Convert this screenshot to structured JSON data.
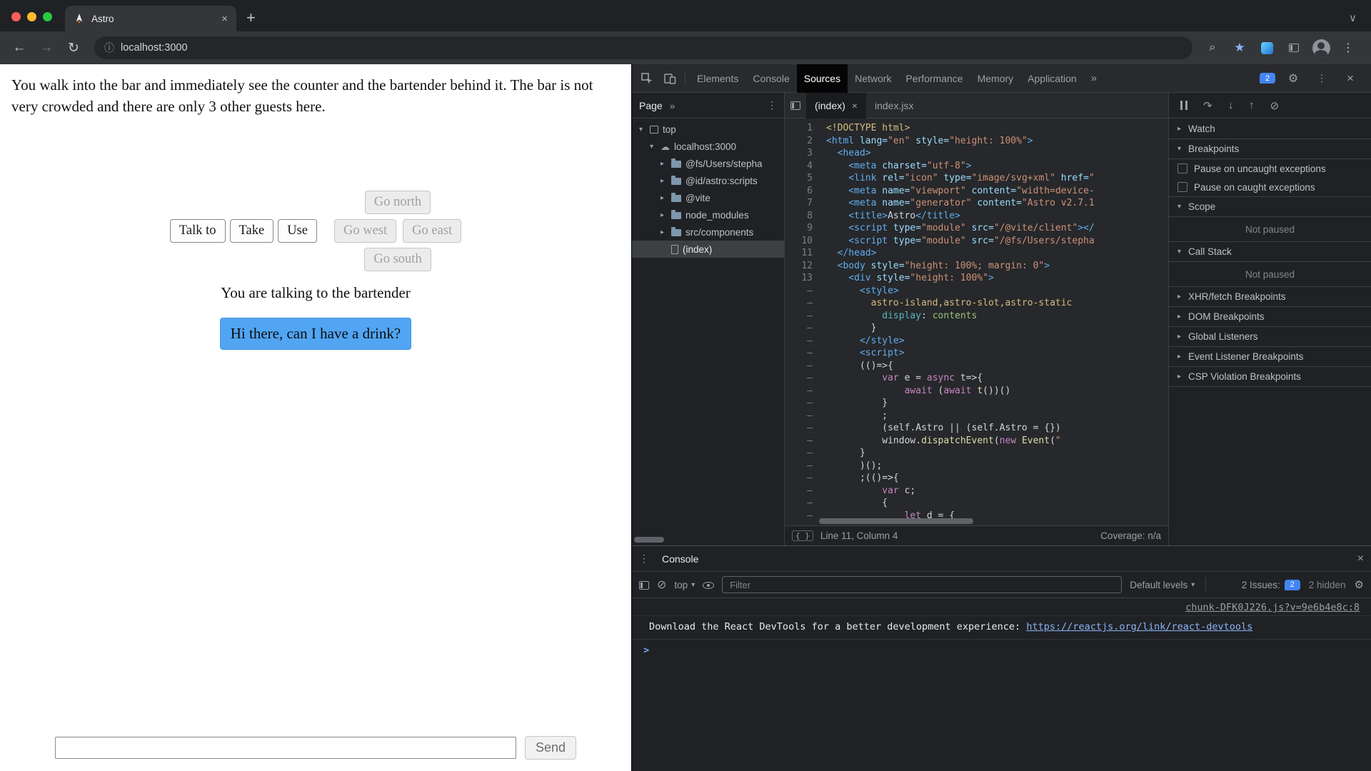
{
  "colors": {
    "accent_blue": "#51a5f3",
    "link_blue": "#8ab4f8",
    "issue_blue": "#4285f4",
    "traffic_red": "#ff5f57",
    "traffic_yellow": "#febc2e",
    "traffic_green": "#28c840"
  },
  "icons": {
    "back": "←",
    "forward": "→",
    "reload": "↻",
    "info": "ⓘ",
    "star": "★",
    "kebab": "⋮",
    "close": "×",
    "new_tab": "+",
    "chevron_down": "∨",
    "more": "»",
    "gear": "⚙",
    "clear": "⊘",
    "caret": "▾",
    "prompt": ">",
    "step_over": "↷",
    "step_into": "↓",
    "step_out": "↑",
    "deactivate": "⊘",
    "search": "⌕"
  },
  "browser": {
    "tab_title": "Astro",
    "url": "localhost:3000"
  },
  "page": {
    "narrative": "You walk into the bar and immediately see the counter and the bartender behind it. The bar is not very crowded and there are only 3 other guests here.",
    "buttons": {
      "go_north": "Go north",
      "talk_to": "Talk to",
      "take": "Take",
      "use": "Use",
      "go_west": "Go west",
      "go_east": "Go east",
      "go_south": "Go south"
    },
    "status_text": "You are talking to the bartender",
    "dialog_option": "Hi there, can I have a drink?",
    "input_value": "",
    "send_label": "Send"
  },
  "devtools": {
    "tabs": [
      "Elements",
      "Console",
      "Sources",
      "Network",
      "Performance",
      "Memory",
      "Application"
    ],
    "active_tab": "Sources",
    "issues_count": "2",
    "sources": {
      "pane_tab": "Page",
      "tree": [
        {
          "label": "top",
          "icon": "frame",
          "arrow": "▾",
          "indent": 0
        },
        {
          "label": "localhost:3000",
          "icon": "cloud",
          "arrow": "▾",
          "indent": 1
        },
        {
          "label": "@fs/Users/stepha",
          "icon": "folder",
          "arrow": "▸",
          "indent": 2
        },
        {
          "label": "@id/astro:scripts",
          "icon": "folder",
          "arrow": "▸",
          "indent": 2
        },
        {
          "label": "@vite",
          "icon": "folder",
          "arrow": "▸",
          "indent": 2
        },
        {
          "label": "node_modules",
          "icon": "folder",
          "arrow": "▸",
          "indent": 2
        },
        {
          "label": "src/components",
          "icon": "folder",
          "arrow": "▸",
          "indent": 2
        },
        {
          "label": "(index)",
          "icon": "file",
          "arrow": "",
          "indent": 2,
          "selected": true
        }
      ],
      "editor_tabs": [
        {
          "label": "(index)",
          "active": true,
          "closable": true
        },
        {
          "label": "index.jsx",
          "active": false,
          "closable": false
        }
      ],
      "code": [
        {
          "n": "1",
          "s": [
            [
              "dt",
              "<!DOCTYPE html>"
            ]
          ]
        },
        {
          "n": "2",
          "s": [
            [
              "tg",
              "<html"
            ],
            [
              "at",
              " lang="
            ],
            [
              "st",
              "\"en\""
            ],
            [
              "at",
              " style="
            ],
            [
              "st",
              "\"height: 100%\""
            ],
            [
              "tg",
              ">"
            ]
          ]
        },
        {
          "n": "3",
          "s": [
            [
              "tg",
              "  <head>"
            ]
          ]
        },
        {
          "n": "4",
          "s": [
            [
              "tg",
              "    <meta"
            ],
            [
              "at",
              " charset="
            ],
            [
              "st",
              "\"utf-8\""
            ],
            [
              "tg",
              ">"
            ]
          ]
        },
        {
          "n": "5",
          "s": [
            [
              "tg",
              "    <link"
            ],
            [
              "at",
              " rel="
            ],
            [
              "st",
              "\"icon\""
            ],
            [
              "at",
              " type="
            ],
            [
              "st",
              "\"image/svg+xml\""
            ],
            [
              "at",
              " href="
            ],
            [
              "st",
              "\""
            ]
          ]
        },
        {
          "n": "6",
          "s": [
            [
              "tg",
              "    <meta"
            ],
            [
              "at",
              " name="
            ],
            [
              "st",
              "\"viewport\""
            ],
            [
              "at",
              " content="
            ],
            [
              "st",
              "\"width=device-"
            ]
          ]
        },
        {
          "n": "7",
          "s": [
            [
              "tg",
              "    <meta"
            ],
            [
              "at",
              " name="
            ],
            [
              "st",
              "\"generator\""
            ],
            [
              "at",
              " content="
            ],
            [
              "st",
              "\"Astro v2.7.1"
            ]
          ]
        },
        {
          "n": "8",
          "s": [
            [
              "tg",
              "    <title>"
            ],
            [
              "pl",
              "Astro"
            ],
            [
              "tg",
              "</title>"
            ]
          ]
        },
        {
          "n": "9",
          "s": [
            [
              "tg",
              "    <script"
            ],
            [
              "at",
              " type="
            ],
            [
              "st",
              "\"module\""
            ],
            [
              "at",
              " src="
            ],
            [
              "st",
              "\"/@vite/client\""
            ],
            [
              "tg",
              "></"
            ]
          ]
        },
        {
          "n": "10",
          "s": [
            [
              "tg",
              "    <script"
            ],
            [
              "at",
              " type="
            ],
            [
              "st",
              "\"module\""
            ],
            [
              "at",
              " src="
            ],
            [
              "st",
              "\"/@fs/Users/stepha"
            ]
          ]
        },
        {
          "n": "11",
          "s": [
            [
              "tg",
              "  </head>"
            ]
          ]
        },
        {
          "n": "12",
          "s": [
            [
              "tg",
              "  <body"
            ],
            [
              "at",
              " style="
            ],
            [
              "st",
              "\"height: 100%; margin: 0\""
            ],
            [
              "tg",
              ">"
            ]
          ]
        },
        {
          "n": "13",
          "s": [
            [
              "tg",
              "    <div"
            ],
            [
              "at",
              " style="
            ],
            [
              "st",
              "\"height: 100%\""
            ],
            [
              "tg",
              ">"
            ]
          ]
        },
        {
          "n": "–",
          "s": [
            [
              "tg",
              "      <style>"
            ]
          ]
        },
        {
          "n": "–",
          "s": [
            [
              "sel",
              "        astro-island,astro-slot,astro-static"
            ]
          ]
        },
        {
          "n": "–",
          "s": [
            [
              "pr",
              "          display"
            ],
            [
              "pl",
              ": "
            ],
            [
              "vl",
              "contents"
            ]
          ]
        },
        {
          "n": "–",
          "s": [
            [
              "pl",
              "        }"
            ]
          ]
        },
        {
          "n": "–",
          "s": [
            [
              "tg",
              "      </style>"
            ]
          ]
        },
        {
          "n": "–",
          "s": [
            [
              "tg",
              "      <script>"
            ]
          ]
        },
        {
          "n": "–",
          "s": [
            [
              "pl",
              "      (()=>{"
            ]
          ]
        },
        {
          "n": "–",
          "s": [
            [
              "pl",
              "          "
            ],
            [
              "kw",
              "var"
            ],
            [
              "pl",
              " e = "
            ],
            [
              "kw",
              "async"
            ],
            [
              "pl",
              " t=>{"
            ]
          ]
        },
        {
          "n": "–",
          "s": [
            [
              "pl",
              "              "
            ],
            [
              "kw",
              "await"
            ],
            [
              "pl",
              " ("
            ],
            [
              "kw",
              "await"
            ],
            [
              "pl",
              " "
            ],
            [
              "fn",
              "t"
            ],
            [
              "pl",
              "())()"
            ]
          ]
        },
        {
          "n": "–",
          "s": [
            [
              "pl",
              "          }"
            ]
          ]
        },
        {
          "n": "–",
          "s": [
            [
              "pl",
              "          ;"
            ]
          ]
        },
        {
          "n": "–",
          "s": [
            [
              "pl",
              "          (self.Astro || (self.Astro = {})"
            ]
          ]
        },
        {
          "n": "–",
          "s": [
            [
              "pl",
              "          window."
            ],
            [
              "fn",
              "dispatchEvent"
            ],
            [
              "pl",
              "("
            ],
            [
              "kw",
              "new"
            ],
            [
              "pl",
              " "
            ],
            [
              "fn",
              "Event"
            ],
            [
              "pl",
              "("
            ],
            [
              "st",
              "\""
            ]
          ]
        },
        {
          "n": "–",
          "s": [
            [
              "pl",
              "      }"
            ]
          ]
        },
        {
          "n": "–",
          "s": [
            [
              "pl",
              "      )();"
            ]
          ]
        },
        {
          "n": "–",
          "s": [
            [
              "pl",
              "      ;(()=>{"
            ]
          ]
        },
        {
          "n": "–",
          "s": [
            [
              "pl",
              "          "
            ],
            [
              "kw",
              "var"
            ],
            [
              "pl",
              " c;"
            ]
          ]
        },
        {
          "n": "–",
          "s": [
            [
              "pl",
              "          {"
            ]
          ]
        },
        {
          "n": "–",
          "s": [
            [
              "pl",
              "              "
            ],
            [
              "kw",
              "let"
            ],
            [
              "pl",
              " d = {"
            ]
          ]
        }
      ],
      "status_left": "Line 11, Column 4",
      "status_right": "Coverage: n/a"
    },
    "debugger": {
      "sections": [
        {
          "label": "Watch",
          "arrow": "▸"
        },
        {
          "label": "Breakpoints",
          "arrow": "▾",
          "checkboxes": [
            "Pause on uncaught exceptions",
            "Pause on caught exceptions"
          ]
        },
        {
          "label": "Scope",
          "arrow": "▾",
          "status": "Not paused"
        },
        {
          "label": "Call Stack",
          "arrow": "▾",
          "status": "Not paused"
        },
        {
          "label": "XHR/fetch Breakpoints",
          "arrow": "▸"
        },
        {
          "label": "DOM Breakpoints",
          "arrow": "▸"
        },
        {
          "label": "Global Listeners",
          "arrow": "▸"
        },
        {
          "label": "Event Listener Breakpoints",
          "arrow": "▸"
        },
        {
          "label": "CSP Violation Breakpoints",
          "arrow": "▸"
        }
      ]
    },
    "console": {
      "tab": "Console",
      "context": "top",
      "filter_placeholder": "Filter",
      "levels": "Default levels",
      "issues_label": "2 Issues:",
      "issues_count": "2",
      "hidden_label": "2 hidden",
      "log_source": "chunk-DFK0J226.js?v=9e6b4e8c:8",
      "log_message": "Download the React DevTools for a better development experience: ",
      "log_link": "https://reactjs.org/link/react-devtools"
    }
  }
}
